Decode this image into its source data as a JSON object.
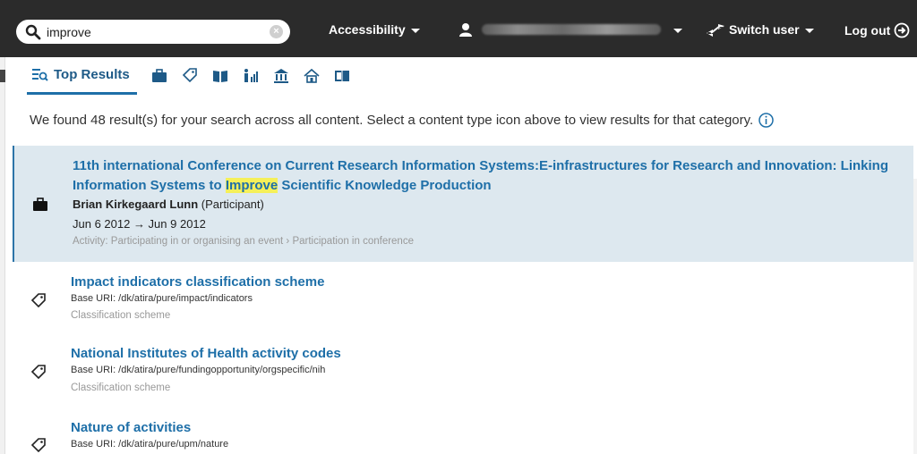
{
  "search": {
    "value": "improve",
    "clear_label": "×"
  },
  "nav": {
    "accessibility": "Accessibility",
    "switch_user": "Switch user",
    "log_out": "Log out"
  },
  "tabs": {
    "top_results": "Top Results"
  },
  "summary": "We found 48 result(s) for your search across all content. Select a content type icon above to view results for that category.",
  "results": [
    {
      "title_line1": "11th international Conference on Current Research Information Systems:E-infrastructures for Research and Innovation: Linking",
      "title_line2_before": "Information Systems to ",
      "title_highlight": "Improve",
      "title_line2_after": " Scientific Knowledge Production",
      "person": "Brian Kirkegaard Lunn",
      "role": "(Participant)",
      "dates": "Jun 6 2012 → Jun 9 2012",
      "type": "Activity: Participating in or organising an event › Participation in conference",
      "icon": "briefcase-icon"
    },
    {
      "title": "Impact indicators classification scheme",
      "uri": "Base URI: /dk/atira/pure/impact/indicators",
      "type": "Classification scheme",
      "icon": "tag-icon"
    },
    {
      "title": "National Institutes of Health activity codes",
      "uri": "Base URI: /dk/atira/pure/fundingopportunity/orgspecific/nih",
      "type": "Classification scheme",
      "icon": "tag-icon"
    },
    {
      "title": "Nature of activities",
      "uri": "Base URI: /dk/atira/pure/upm/nature",
      "icon": "tag-icon"
    }
  ],
  "colors": {
    "topbar": "#2b2b2b",
    "link": "#1e6fa8",
    "highlight": "#f5f05a",
    "selected_bg": "#dde8ef"
  }
}
